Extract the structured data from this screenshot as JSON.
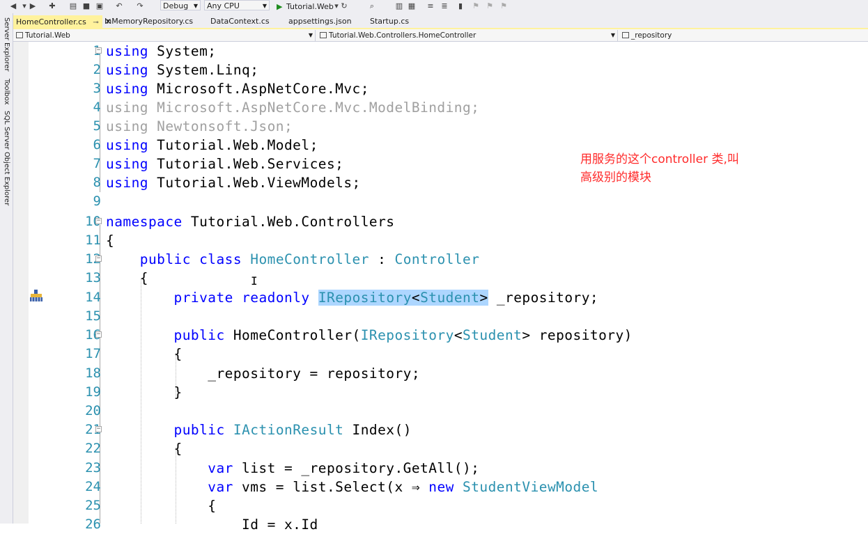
{
  "toolbar": {
    "config": "Debug",
    "platform": "Any CPU",
    "run_target": "Tutorial.Web"
  },
  "side_tabs": [
    "Server Explorer",
    "Toolbox",
    "SQL Server Object Explorer"
  ],
  "tabs": [
    {
      "label": "HomeController.cs",
      "active": true
    },
    {
      "label": "InMemoryRepository.cs"
    },
    {
      "label": "DataContext.cs"
    },
    {
      "label": "appsettings.json"
    },
    {
      "label": "Startup.cs"
    }
  ],
  "nav": {
    "project": "Tutorial.Web",
    "type": "Tutorial.Web.Controllers.HomeController",
    "member": "_repository"
  },
  "code": {
    "lines": [
      "1",
      "2",
      "3",
      "4",
      "5",
      "6",
      "7",
      "8",
      "9",
      "10",
      "11",
      "12",
      "13",
      "14",
      "15",
      "16",
      "17",
      "18",
      "19",
      "20",
      "21",
      "22",
      "23",
      "24",
      "25",
      "26"
    ],
    "text": {
      "l1": [
        "using",
        " System;"
      ],
      "l2": [
        "using",
        " System.Linq;"
      ],
      "l3": [
        "using",
        " Microsoft.AspNetCore.Mvc;"
      ],
      "l4": [
        "using",
        " Microsoft.AspNetCore.Mvc.ModelBinding;"
      ],
      "l5": [
        "using",
        " Newtonsoft.Json;"
      ],
      "l6": [
        "using",
        " Tutorial.Web.Model;"
      ],
      "l7": [
        "using",
        " Tutorial.Web.Services;"
      ],
      "l8": [
        "using",
        " Tutorial.Web.ViewModels;"
      ],
      "l10": [
        "namespace",
        " Tutorial.Web.Controllers"
      ],
      "l11": "{",
      "l12": [
        "    ",
        "public",
        " ",
        "class",
        " ",
        "HomeController",
        " : ",
        "Controller"
      ],
      "l13": "    {",
      "l14": [
        "        ",
        "private",
        " ",
        "readonly",
        " ",
        "IRepository",
        "<",
        "Student",
        ">",
        " _repository;"
      ],
      "l16": [
        "        ",
        "public",
        " HomeController(",
        "IRepository",
        "<",
        "Student",
        "> repository)"
      ],
      "l17": "        {",
      "l18": "            _repository = repository;",
      "l19": "        }",
      "l21": [
        "        ",
        "public",
        " ",
        "IActionResult",
        " Index()"
      ],
      "l22": "        {",
      "l23": [
        "            ",
        "var",
        " list = _repository.GetAll();"
      ],
      "l24": [
        "            ",
        "var",
        " vms = list.Select(x ",
        "⇒",
        " ",
        "new",
        " ",
        "StudentViewModel"
      ],
      "l25": "            {",
      "l26": "                Id = x.Id"
    }
  },
  "annotation": {
    "line1": "用服务的这个controller 类,叫",
    "line2": "高级别的模块"
  },
  "colors": {
    "keyword": "#0000ff",
    "type": "#2b91af",
    "line_number": "#2b91af",
    "unused": "#a0a0a0",
    "selection": "#add6ff",
    "active_tab": "#fff29d",
    "annotation": "#ff2a2a"
  }
}
